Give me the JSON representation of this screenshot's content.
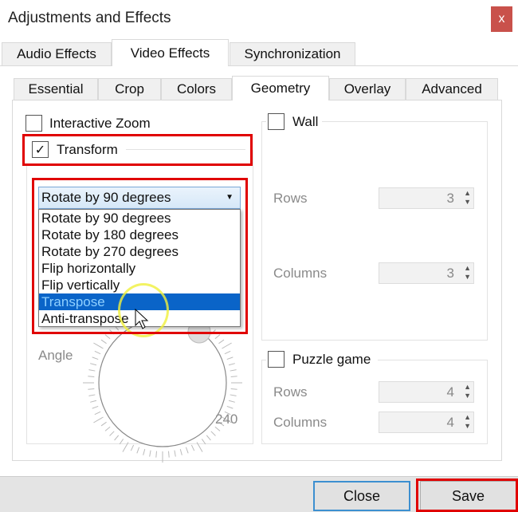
{
  "window": {
    "title": "Adjustments and Effects",
    "close_glyph": "x",
    "close_color": "#c9514b"
  },
  "tabs": [
    {
      "label": "Audio Effects"
    },
    {
      "label": "Video Effects",
      "selected": true
    },
    {
      "label": "Synchronization"
    }
  ],
  "subtabs": [
    {
      "label": "Essential"
    },
    {
      "label": "Crop"
    },
    {
      "label": "Colors"
    },
    {
      "label": "Geometry",
      "selected": true
    },
    {
      "label": "Overlay"
    },
    {
      "label": "Advanced"
    }
  ],
  "geometry": {
    "interactive_zoom": {
      "label": "Interactive Zoom",
      "checked": false
    },
    "transform": {
      "label": "Transform",
      "checked": true,
      "check_glyph": "✓",
      "selected": "Rotate by 90 degrees",
      "options": [
        "Rotate by 90 degrees",
        "Rotate by 180 degrees",
        "Rotate by 270 degrees",
        "Flip horizontally",
        "Flip vertically",
        "Transpose",
        "Anti-transpose"
      ],
      "highlighted": "Transpose"
    },
    "angle": {
      "label": "Angle",
      "tick_label": "240"
    },
    "wall": {
      "label": "Wall",
      "checked": false,
      "rows_label": "Rows",
      "rows": "3",
      "columns_label": "Columns",
      "columns": "3"
    },
    "puzzle": {
      "label": "Puzzle game",
      "checked": false,
      "rows_label": "Rows",
      "rows": "4",
      "columns_label": "Columns",
      "columns": "4"
    }
  },
  "footer": {
    "close_label": "Close",
    "save_label": "Save"
  },
  "highlight_color": "#e00000"
}
